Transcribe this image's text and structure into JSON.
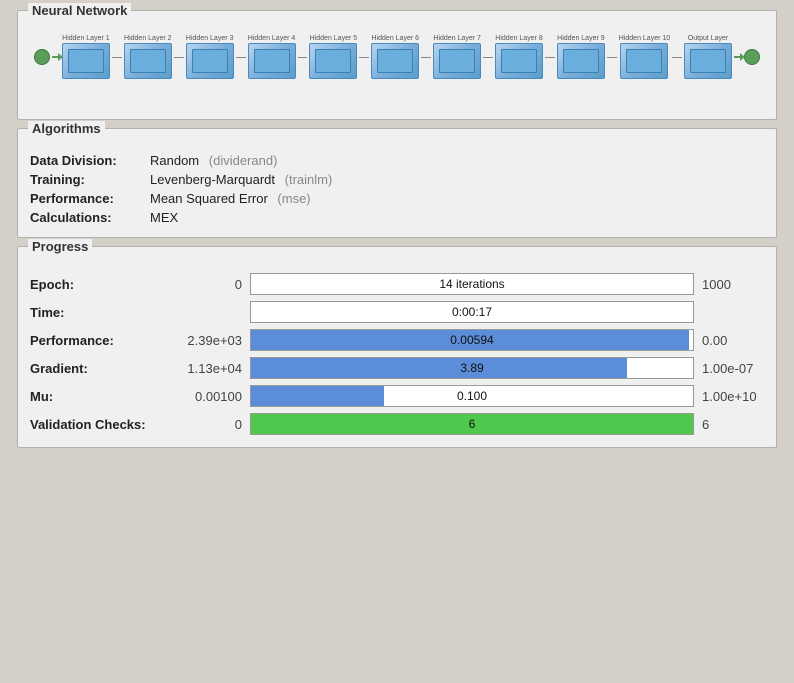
{
  "neural_network": {
    "title": "Neural Network",
    "nodes": [
      {
        "label": "Hidden Layer 1"
      },
      {
        "label": "Hidden Layer 2"
      },
      {
        "label": "Hidden Layer 3"
      },
      {
        "label": "Hidden Layer 4"
      },
      {
        "label": "Hidden Layer 5"
      },
      {
        "label": "Hidden Layer 6"
      },
      {
        "label": "Hidden Layer 7"
      },
      {
        "label": "Hidden Layer 8"
      },
      {
        "label": "Hidden Layer 9"
      },
      {
        "label": "Hidden Layer 10"
      },
      {
        "label": "Output Layer"
      }
    ]
  },
  "algorithms": {
    "title": "Algorithms",
    "rows": [
      {
        "label": "Data Division:",
        "value": "Random",
        "sub": "(dividerand)"
      },
      {
        "label": "Training:",
        "value": "Levenberg-Marquardt",
        "sub": "(trainlm)"
      },
      {
        "label": "Performance:",
        "value": "Mean Squared Error",
        "sub": "(mse)"
      },
      {
        "label": "Calculations:",
        "value": "MEX",
        "sub": ""
      }
    ]
  },
  "progress": {
    "title": "Progress",
    "rows": [
      {
        "label": "Epoch:",
        "start": "0",
        "bar_text": "14 iterations",
        "bar_fill_pct": 1.4,
        "bar_type": "white",
        "end": "1000"
      },
      {
        "label": "Time:",
        "start": "",
        "bar_text": "0:00:17",
        "bar_fill_pct": 0,
        "bar_type": "white",
        "end": ""
      },
      {
        "label": "Performance:",
        "start": "2.39e+03",
        "bar_text": "0.00594",
        "bar_fill_pct": 99,
        "bar_type": "blue",
        "end": "0.00"
      },
      {
        "label": "Gradient:",
        "start": "1.13e+04",
        "bar_text": "3.89",
        "bar_fill_pct": 85,
        "bar_type": "blue",
        "end": "1.00e-07"
      },
      {
        "label": "Mu:",
        "start": "0.00100",
        "bar_text": "0.100",
        "bar_fill_pct": 30,
        "bar_type": "blue",
        "end": "1.00e+10"
      },
      {
        "label": "Validation Checks:",
        "start": "0",
        "bar_text": "6",
        "bar_fill_pct": 100,
        "bar_type": "green",
        "end": "6"
      }
    ]
  }
}
